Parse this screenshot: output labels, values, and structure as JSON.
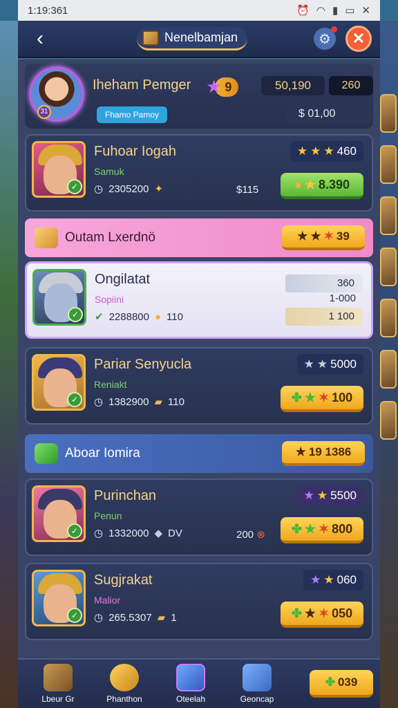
{
  "status": {
    "time": "1:19:361"
  },
  "header": {
    "title": "Nenelbamjan"
  },
  "profile": {
    "name": "Iheham Pemger",
    "tag": "Fhamo Pamoy",
    "level": "31",
    "coins": "9",
    "stat1": "50,190",
    "stat2": "260",
    "balance": "$ 01,00"
  },
  "cards": [
    {
      "name": "Fuhoar Iogah",
      "sub": "Samuk",
      "meta": "2305200",
      "extra": "$115",
      "rating": "460",
      "buy": "8.390",
      "buy_style": "green"
    },
    {
      "name": "Ongilatat",
      "sub": "Sopiini",
      "meta": "2288800",
      "extra": "110",
      "mini1": "360",
      "mini_mid": "1-000",
      "mini2": "1 100"
    },
    {
      "name": "Pariar Senyucla",
      "sub": "Reniakt",
      "meta": "1382900",
      "extra": "110",
      "rating": "5000",
      "buy": "100"
    },
    {
      "name": "Purinchan",
      "sub": "Penun",
      "meta": "1332000",
      "extra": "DV",
      "extra2": "200",
      "rating": "5500",
      "buy": "800"
    },
    {
      "name": "Sugjrakat",
      "sub": "Malior",
      "meta": "265.5307",
      "extra": "1",
      "rating": "060",
      "buy": "050"
    }
  ],
  "banners": [
    {
      "text": "Outam Lxerdnö",
      "value": "39"
    },
    {
      "text": "Aboar Iomira",
      "value": "19 1386"
    }
  ],
  "nav": {
    "items": [
      "Lbeur Gr",
      "Phanthon",
      "Oteelah",
      "Geoncap"
    ],
    "button": "039"
  }
}
